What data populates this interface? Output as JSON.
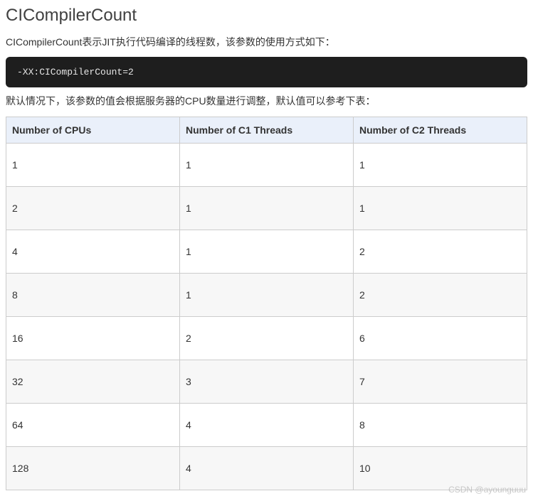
{
  "heading": "CICompilerCount",
  "intro": "CICompilerCount表示JIT执行代码编译的线程数，该参数的使用方式如下：",
  "code": "-XX:CICompilerCount=2",
  "table_intro": "默认情况下，该参数的值会根据服务器的CPU数量进行调整，默认值可以参考下表：",
  "table": {
    "headers": [
      "Number of CPUs",
      "Number of C1 Threads",
      "Number of C2 Threads"
    ],
    "rows": [
      [
        "1",
        "1",
        "1"
      ],
      [
        "2",
        "1",
        "1"
      ],
      [
        "4",
        "1",
        "2"
      ],
      [
        "8",
        "1",
        "2"
      ],
      [
        "16",
        "2",
        "6"
      ],
      [
        "32",
        "3",
        "7"
      ],
      [
        "64",
        "4",
        "8"
      ],
      [
        "128",
        "4",
        "10"
      ]
    ]
  },
  "watermark": "CSDN @ayounguuu"
}
